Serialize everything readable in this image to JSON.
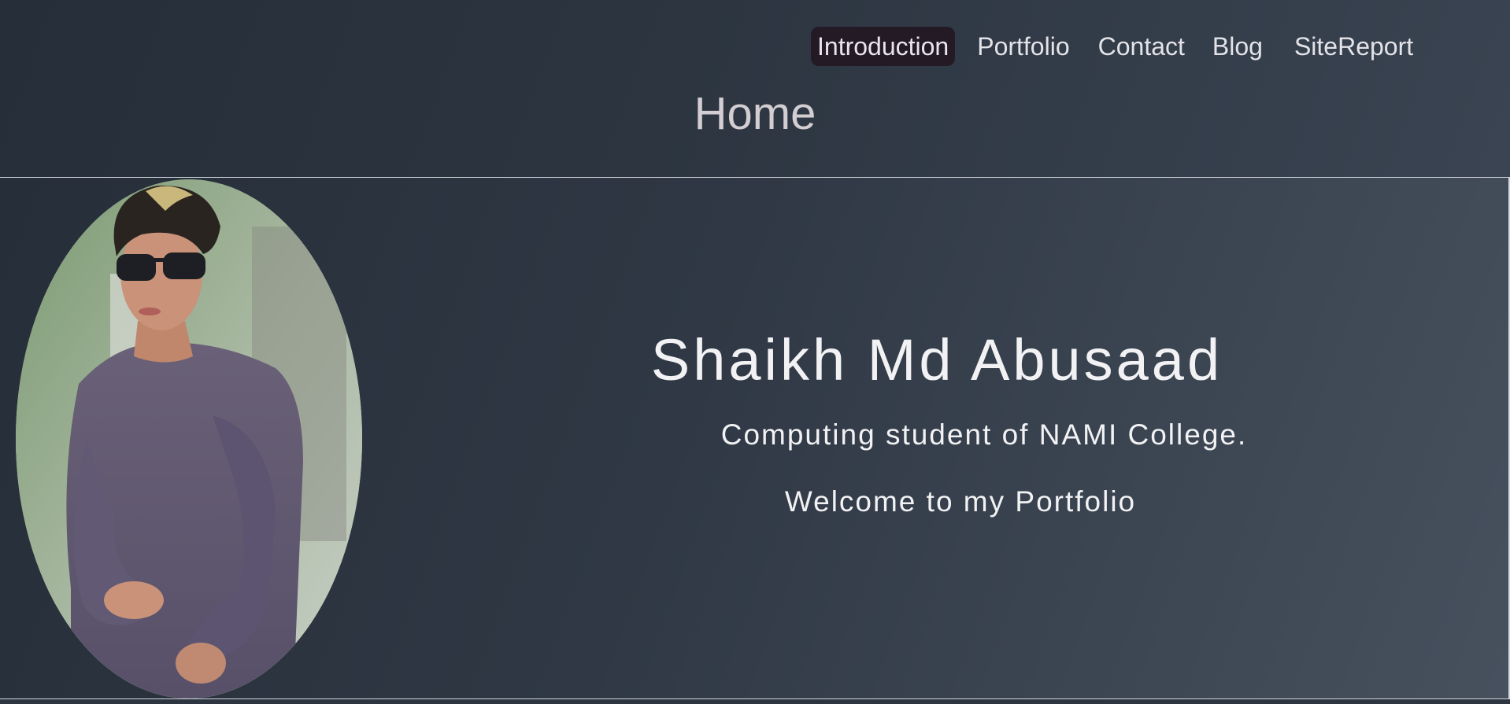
{
  "nav": {
    "items": [
      {
        "label": "Introduction",
        "active": true
      },
      {
        "label": "Portfolio",
        "active": false
      },
      {
        "label": "Contact",
        "active": false
      },
      {
        "label": "Blog",
        "active": false
      },
      {
        "label": "SiteReport",
        "active": false
      }
    ]
  },
  "header": {
    "title": "Home"
  },
  "hero": {
    "name": "Shaikh Md Abusaad",
    "subtitle": "Computing student of NAMI College.",
    "welcome": "Welcome to my Portfolio"
  },
  "colors": {
    "background": "#2b3440",
    "nav_active_bg": "#231a26",
    "text": "#f2f2f4"
  }
}
